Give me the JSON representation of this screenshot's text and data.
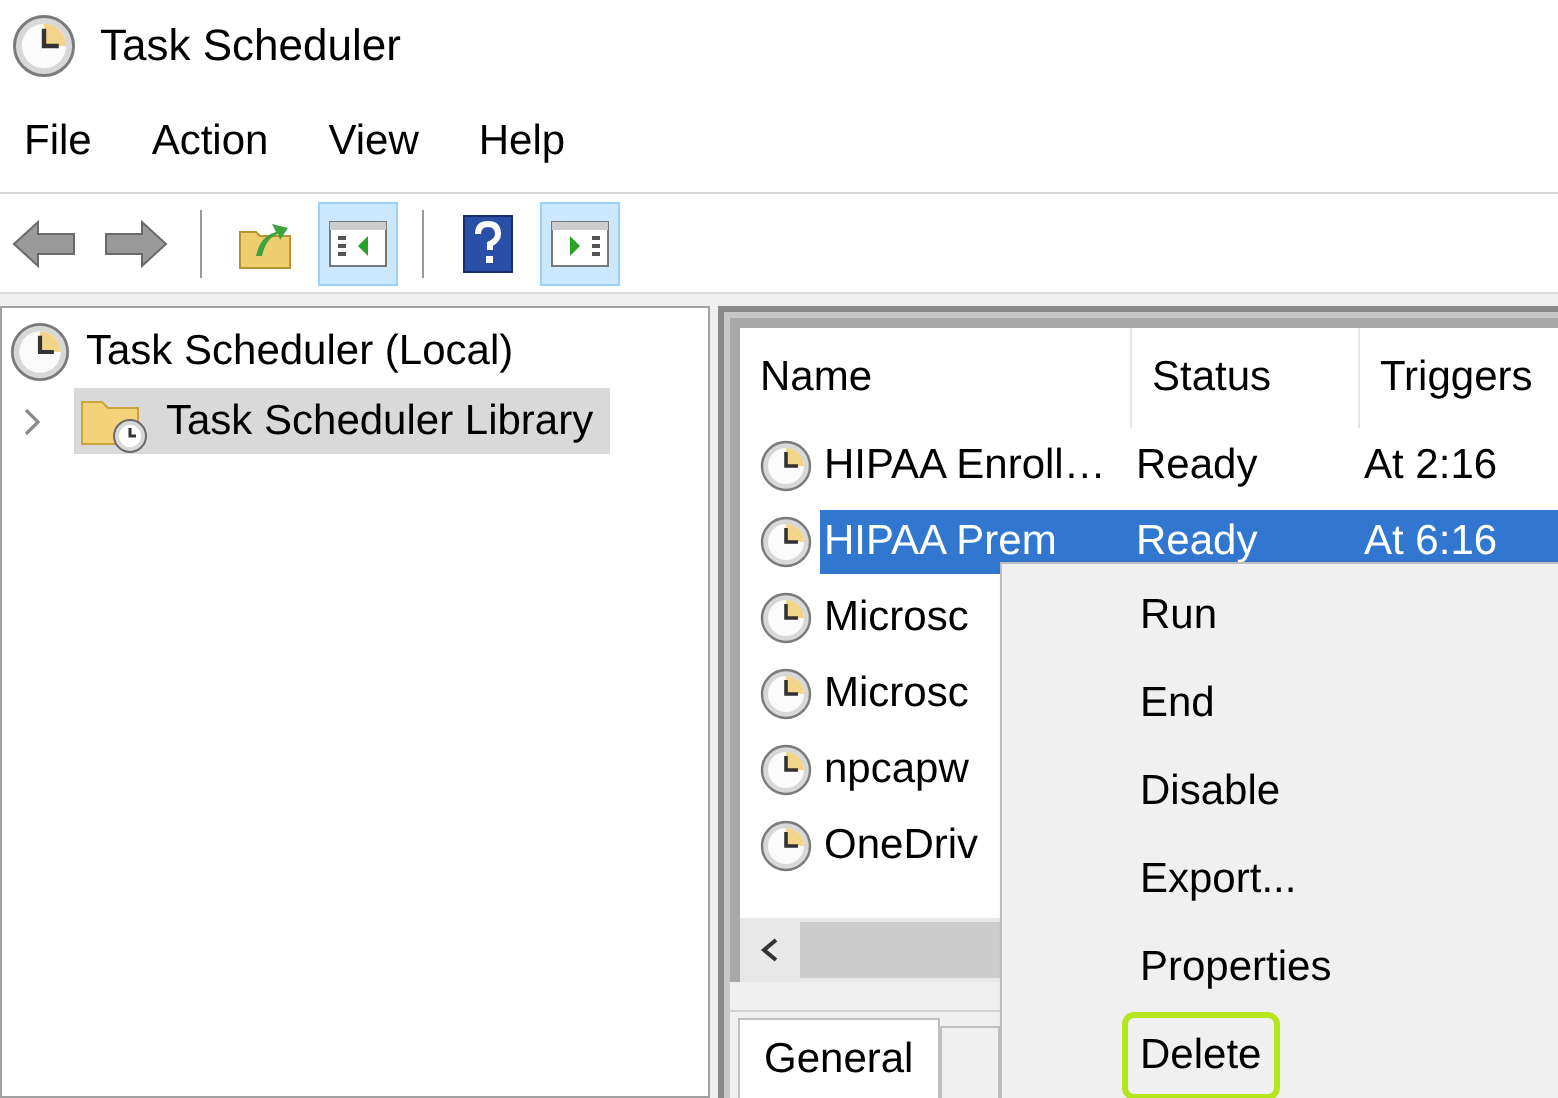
{
  "window": {
    "title": "Task Scheduler"
  },
  "menu": [
    "File",
    "Action",
    "View",
    "Help"
  ],
  "toolbar": [
    {
      "kind": "back",
      "pressed": false
    },
    {
      "kind": "forward",
      "pressed": false
    },
    {
      "kind": "separator"
    },
    {
      "kind": "folder-up",
      "pressed": false
    },
    {
      "kind": "tree-pane",
      "pressed": true
    },
    {
      "kind": "separator"
    },
    {
      "kind": "help",
      "pressed": false
    },
    {
      "kind": "action-pane",
      "pressed": true
    }
  ],
  "tree": [
    {
      "label": "Task Scheduler (Local)",
      "kind": "clock",
      "selected": false,
      "children": [
        {
          "label": "Task Scheduler Library",
          "kind": "folder-clock",
          "selected": true,
          "expanded": false
        }
      ]
    }
  ],
  "table": {
    "columns": [
      "Name",
      "Status",
      "Triggers"
    ],
    "rows": [
      {
        "cells": [
          "HIPAA Enroll…",
          "Ready",
          "At 2:16"
        ],
        "selected": false
      },
      {
        "cells": [
          "HIPAA Prem",
          "Ready",
          "At 6:16"
        ],
        "selected": true
      },
      {
        "cells": [
          "Microsc"
        ],
        "selected": false
      },
      {
        "cells": [
          "Microsc"
        ],
        "selected": false
      },
      {
        "cells": [
          "npcapw"
        ],
        "selected": false
      },
      {
        "cells": [
          "OneDriv"
        ],
        "selected": false
      }
    ]
  },
  "tabs": [
    {
      "label": "General",
      "selected": true
    }
  ],
  "context_menu": {
    "items": [
      {
        "label": "Run",
        "highlighted": false
      },
      {
        "label": "End",
        "highlighted": false
      },
      {
        "label": "Disable",
        "highlighted": false
      },
      {
        "label": "Export...",
        "highlighted": false
      },
      {
        "label": "Properties",
        "highlighted": false
      },
      {
        "label": "Delete",
        "highlighted": true
      }
    ]
  }
}
